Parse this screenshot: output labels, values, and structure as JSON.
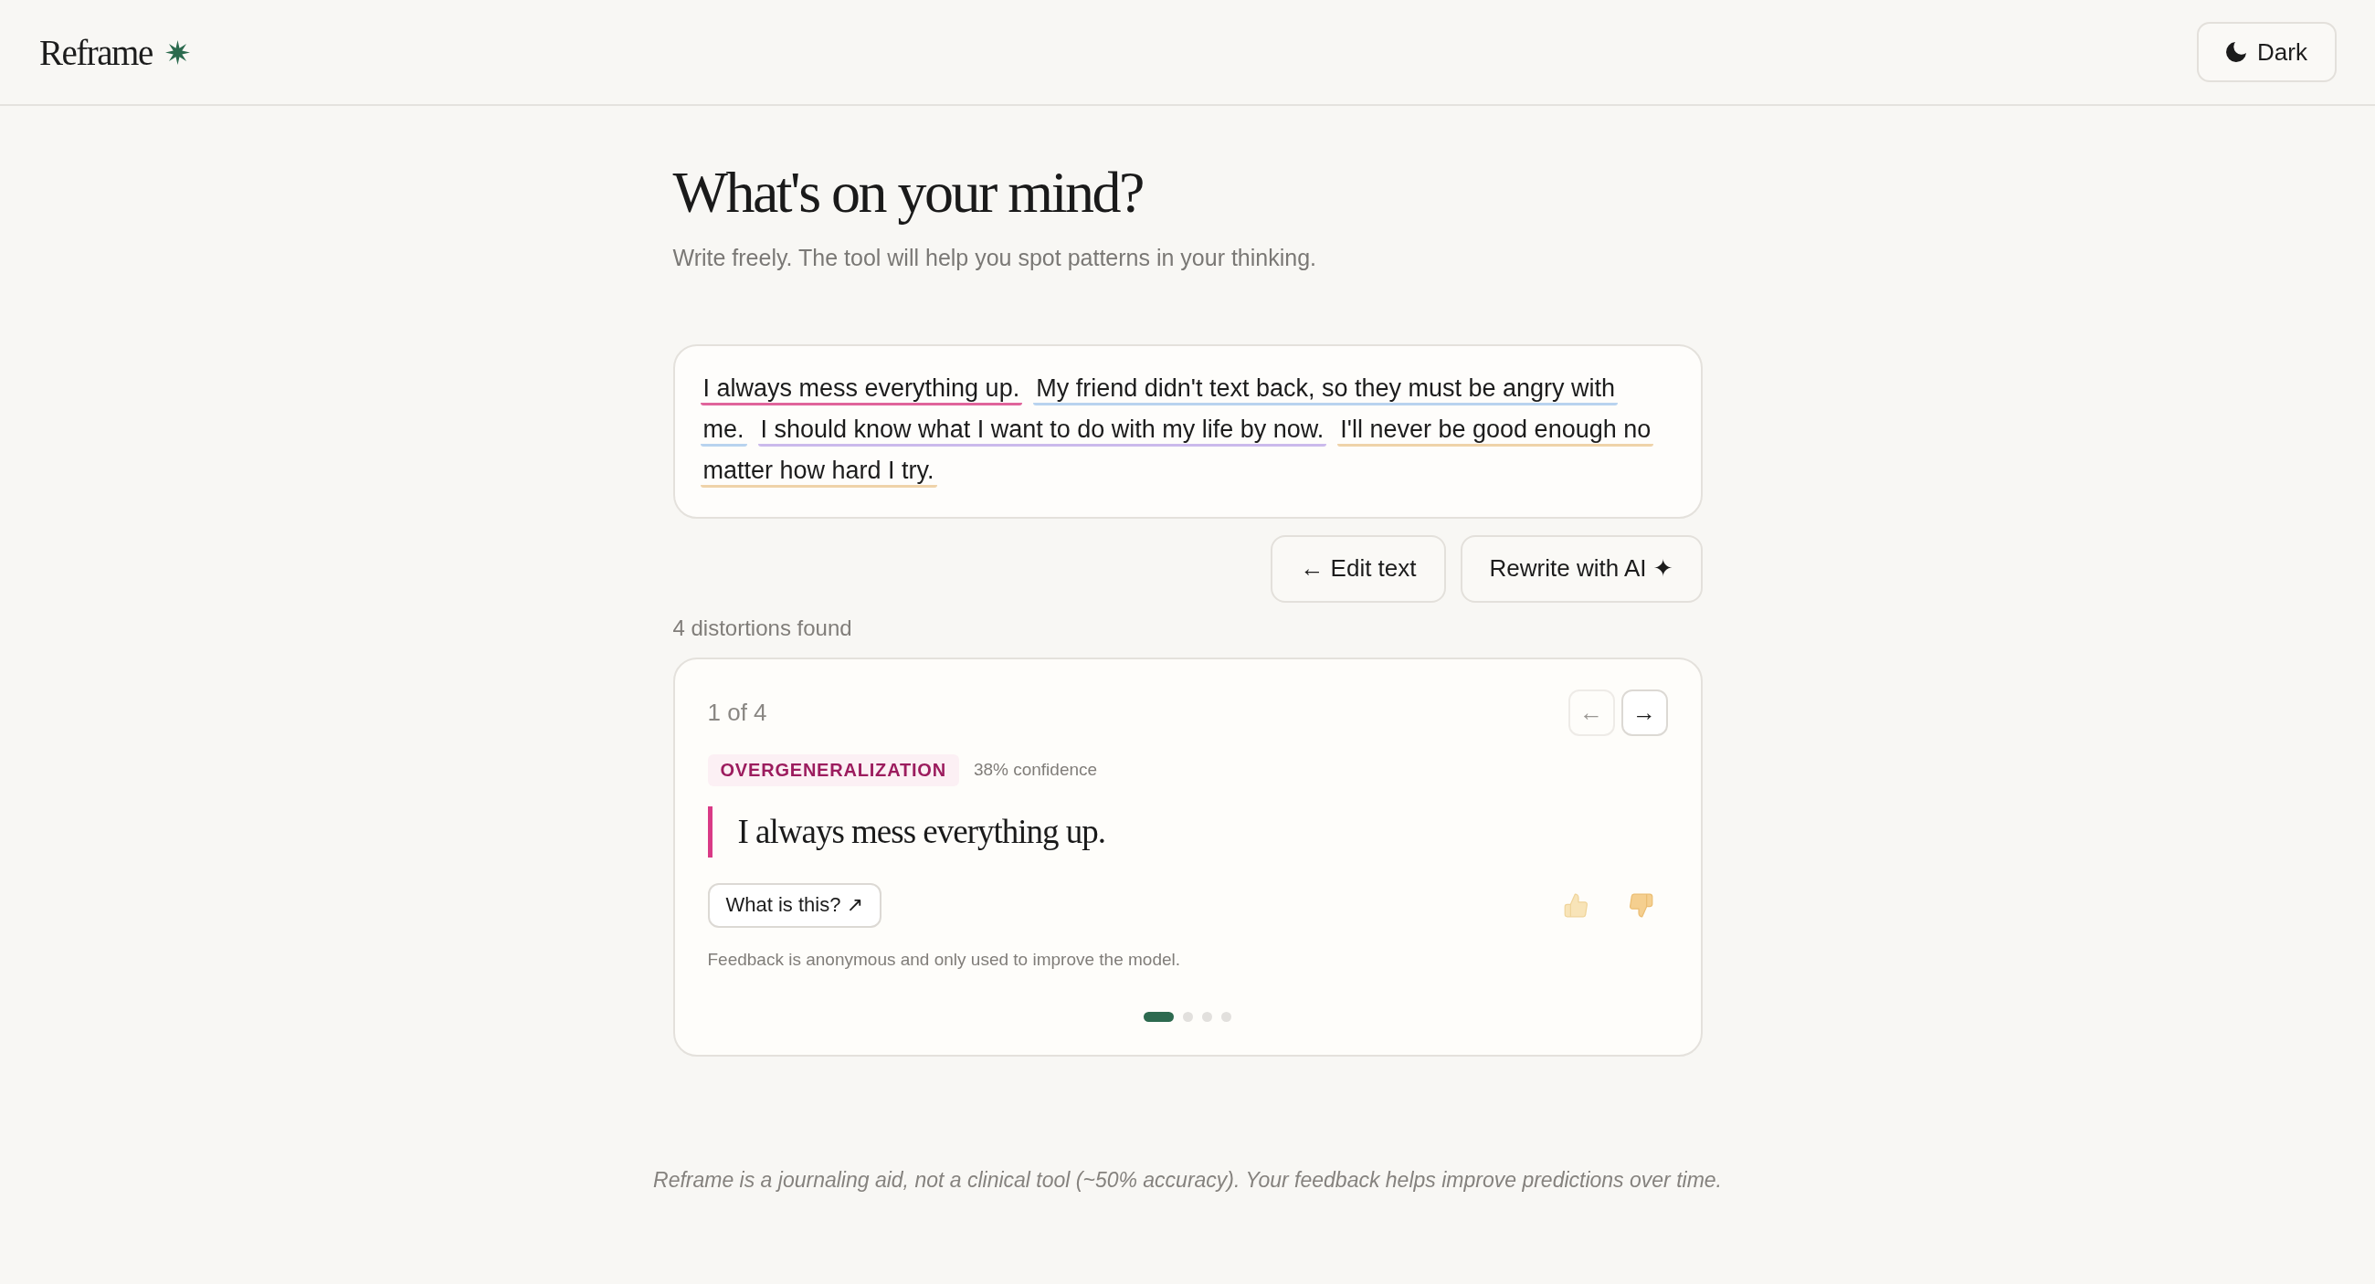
{
  "header": {
    "logo": "Reframe",
    "theme_button": "Dark"
  },
  "prompt": {
    "title": "What's on your mind?",
    "subtitle": "Write freely. The tool will help you spot patterns in your thinking."
  },
  "entry": {
    "lines": [
      [
        {
          "text": "I always mess everything up.",
          "color": "#e0649b"
        },
        {
          "text": "My friend didn't text back, so they must be angry with",
          "color": "#b8d3ef"
        }
      ],
      [
        {
          "text": "me.",
          "color": "#b8d3ef"
        },
        {
          "text": "I should know what I want to do with my life by now.",
          "color": "#cbbaec"
        },
        {
          "text": "I'll never be good enough no",
          "color": "#efd3a9"
        }
      ],
      [
        {
          "text": "matter how hard I try.",
          "color": "#efd3a9"
        }
      ]
    ]
  },
  "actions": [
    {
      "label": "← Edit text"
    },
    {
      "label": "Rewrite with AI ✦"
    }
  ],
  "results": {
    "summary": "4 distortions found",
    "card": {
      "position": "1 of 4",
      "prev": {
        "label": "←",
        "disabled": true
      },
      "next": {
        "label": "→",
        "disabled": false
      },
      "tag": "OVERGENERALIZATION",
      "confidence": "38% confidence",
      "quote": "I always mess everything up.",
      "info_button": "What is this? ↗",
      "note": "Feedback is anonymous and only used to improve the model.",
      "pager": [
        {
          "selected": true
        },
        {
          "selected": false
        },
        {
          "selected": false
        },
        {
          "selected": false
        }
      ]
    }
  },
  "footer": "Reframe is a journaling aid, not a clinical tool (~50% accuracy). Your feedback helps improve predictions over time."
}
